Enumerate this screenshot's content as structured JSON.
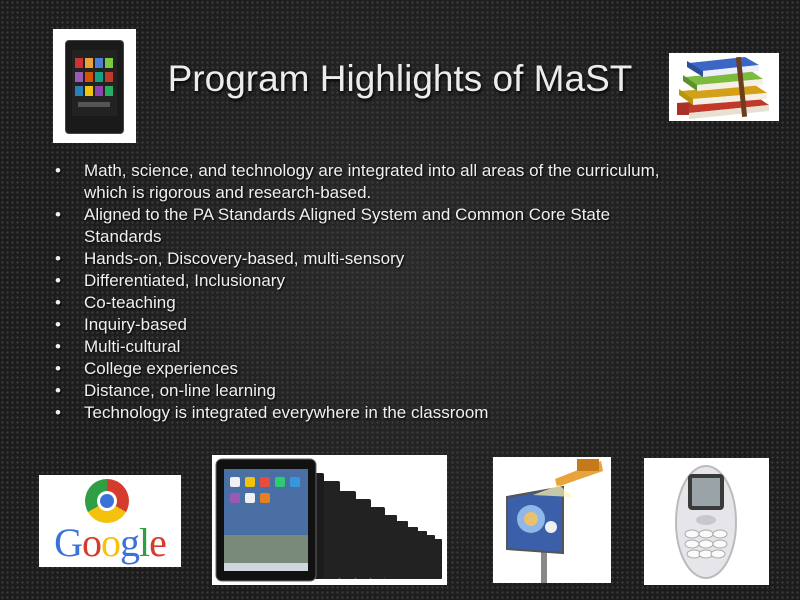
{
  "slide": {
    "title": "Program Highlights of MaST",
    "bullet_symbol": "•",
    "bullets": [
      {
        "lines": [
          "Math, science, and technology are integrated into all areas of the curriculum,",
          "which is rigorous and research-based."
        ]
      },
      {
        "lines": [
          "Aligned to the PA Standards Aligned System and Common Core State",
          "Standards"
        ]
      },
      {
        "lines": [
          "Hands-on, Discovery-based, multi-sensory"
        ]
      },
      {
        "lines": [
          "Differentiated, Inclusionary"
        ]
      },
      {
        "lines": [
          "Co-teaching"
        ]
      },
      {
        "lines": [
          "Inquiry-based"
        ]
      },
      {
        "lines": [
          "Multi-cultural"
        ]
      },
      {
        "lines": [
          "College experiences"
        ]
      },
      {
        "lines": [
          "Distance, on-line learning"
        ]
      },
      {
        "lines": [
          "Technology is integrated everywhere in the classroom"
        ]
      }
    ]
  },
  "images": {
    "top_left": "kindle-tablet-photo",
    "top_right": "stacked-books-photo",
    "bottom": [
      "google-logo",
      "ipad-row-photo",
      "digital-billboard-photo",
      "mobile-phone-photo"
    ]
  },
  "google_logo_text": "Google",
  "colors": {
    "background": "#1c1c1c",
    "text": "#f0f0f0",
    "google_blue": "#3b72d9",
    "google_red": "#d63c2d",
    "google_yellow": "#f4c20d",
    "google_green": "#2f9e44"
  }
}
